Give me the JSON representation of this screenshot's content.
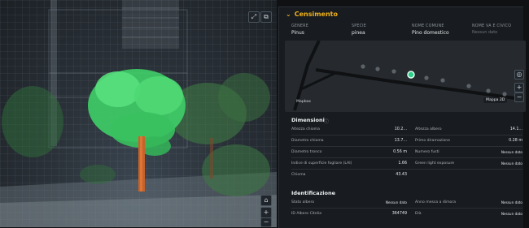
{
  "viewer": {
    "controls": {
      "fullscreen_icon": "expand-icon",
      "layers_icon": "layers-icon",
      "home_icon": "home-icon",
      "zoom_in": "+",
      "zoom_out": "−"
    }
  },
  "panel": {
    "title": "Censimento",
    "fields": [
      {
        "label": "GENERE",
        "value": "Pinus"
      },
      {
        "label": "SPECIE",
        "value": "pinea"
      },
      {
        "label": "NOME COMUNE",
        "value": "Pino domestico"
      },
      {
        "label": "NOME VA E CIVICO",
        "value": "Nessun dato"
      }
    ],
    "map": {
      "left_label": "Mapbox",
      "right_label": "Mappa 2D",
      "controls": {
        "locate_icon": "locate-icon",
        "zoom_in": "+",
        "zoom_out": "−"
      }
    },
    "dimensioni": {
      "title": "Dimensioni",
      "rows": [
        {
          "l": "Altezza chioma",
          "v": "10.2...",
          "l2": "Altezza albero",
          "v2": "14.1..."
        },
        {
          "l": "Diametro chioma",
          "v": "13.7...",
          "l2": "Primo diramazione",
          "v2": "0.28 m"
        },
        {
          "l": "Diametro tronco",
          "v": "0.56 m",
          "l2": "Numero fusti",
          "v2": "Nessun dato"
        },
        {
          "l": "Indice di superficie fogliare (LAI)",
          "v": "1.66",
          "l2": "Green light exposure",
          "v2": "Nessun dato"
        },
        {
          "l": "Chioma",
          "v": "43.43",
          "l2": "",
          "v2": ""
        }
      ]
    },
    "identificazione": {
      "title": "Identificazione",
      "rows": [
        {
          "l": "Stato albero",
          "v": "Nessun dato",
          "l2": "Anno messa a dimora",
          "v2": "Nessun dato"
        },
        {
          "l": "ID Albero Citelia",
          "v": "364749",
          "l2": "Età",
          "v2": "Nessun dato"
        }
      ]
    }
  }
}
